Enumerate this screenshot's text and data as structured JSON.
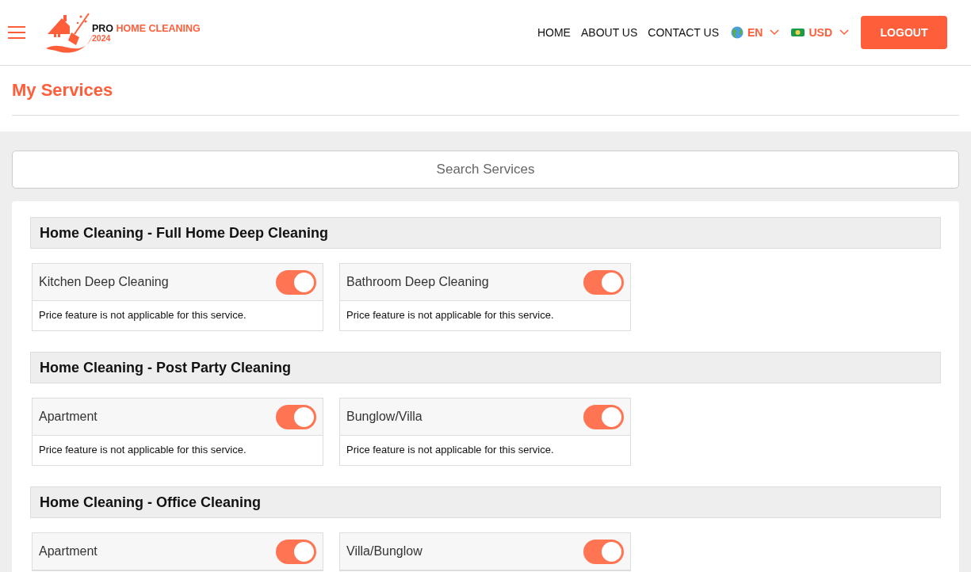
{
  "header": {
    "logo": {
      "brand_dark": "PRO",
      "brand_accent": "HOME CLEANING",
      "year": "2024"
    },
    "nav": [
      {
        "label": "HOME"
      },
      {
        "label": "ABOUT US"
      },
      {
        "label": "CONTACT US"
      }
    ],
    "language": {
      "label": "EN"
    },
    "currency": {
      "label": "USD"
    },
    "logout": "LOGOUT"
  },
  "page_title": "My Services",
  "search": {
    "placeholder": "Search Services"
  },
  "groups": [
    {
      "title": "Home Cleaning - Full Home Deep Cleaning",
      "services": [
        {
          "name": "Kitchen Deep Cleaning",
          "on": true,
          "note": "Price feature is not applicable for this service."
        },
        {
          "name": "Bathroom Deep Cleaning",
          "on": true,
          "note": "Price feature is not applicable for this service."
        }
      ]
    },
    {
      "title": "Home Cleaning - Post Party Cleaning",
      "services": [
        {
          "name": "Apartment",
          "on": true,
          "note": "Price feature is not applicable for this service."
        },
        {
          "name": "Bunglow/Villa",
          "on": true,
          "note": "Price feature is not applicable for this service."
        }
      ]
    },
    {
      "title": "Home Cleaning - Office Cleaning",
      "services": [
        {
          "name": "Apartment",
          "on": true
        },
        {
          "name": "Villa/Bunglow",
          "on": true
        }
      ]
    }
  ]
}
